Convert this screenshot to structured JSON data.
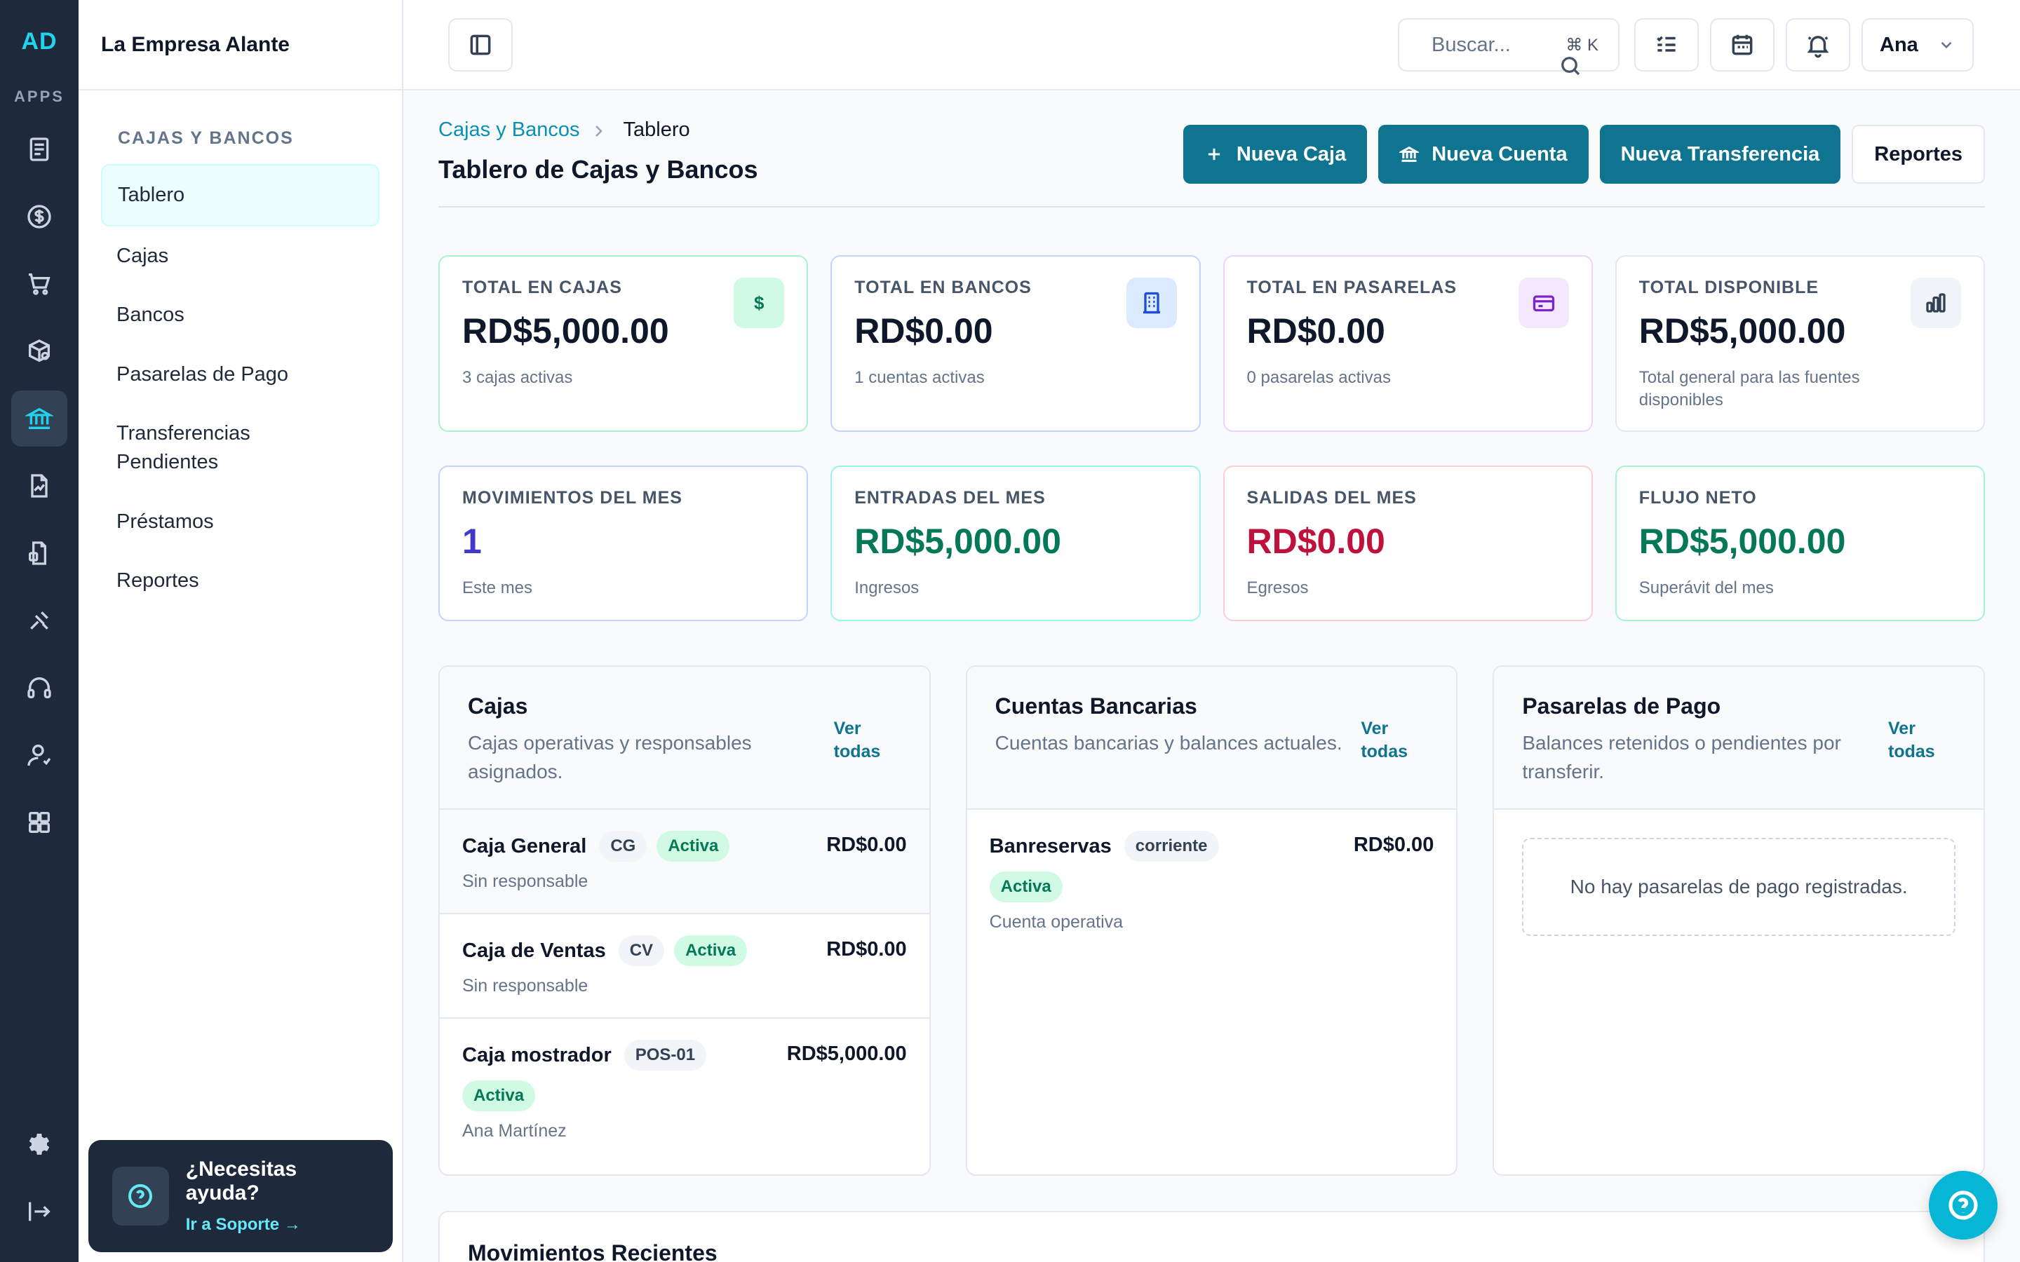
{
  "rail": {
    "logo": "AD",
    "apps_label": "APPS",
    "icons": [
      "document-icon",
      "dollar-icon",
      "cart-icon",
      "package-icon",
      "bank-icon",
      "report-icon",
      "file-chart-icon",
      "tools-icon",
      "headset-icon",
      "user-icon",
      "grid-icon"
    ],
    "bottom_icons": [
      "gear-icon",
      "logout-icon"
    ]
  },
  "sidebar": {
    "company": "La Empresa Alante",
    "section": "CAJAS Y BANCOS",
    "items": [
      {
        "label": "Tablero",
        "active": true
      },
      {
        "label": "Cajas"
      },
      {
        "label": "Bancos"
      },
      {
        "label": "Pasarelas de Pago"
      },
      {
        "label": "Transferencias Pendientes"
      },
      {
        "label": "Préstamos"
      },
      {
        "label": "Reportes"
      }
    ],
    "help": {
      "title": "¿Necesitas ayuda?",
      "link": "Ir a Soporte →"
    }
  },
  "topbar": {
    "search_placeholder": "Buscar...",
    "search_shortcut": "⌘ K",
    "user": "Ana"
  },
  "header": {
    "breadcrumb": [
      "Cajas y Bancos",
      "Tablero"
    ],
    "title": "Tablero de Cajas y Bancos",
    "actions": {
      "new_caja": "Nueva Caja",
      "new_cuenta": "Nueva Cuenta",
      "new_transfer": "Nueva Transferencia",
      "reports": "Reportes"
    }
  },
  "stats": [
    {
      "label": "TOTAL EN CAJAS",
      "value": "RD$5,000.00",
      "sub": "3 cajas activas",
      "icon": "dollar-icon"
    },
    {
      "label": "TOTAL EN BANCOS",
      "value": "RD$0.00",
      "sub": "1 cuentas activas",
      "icon": "building-icon"
    },
    {
      "label": "TOTAL EN PASARELAS",
      "value": "RD$0.00",
      "sub": "0 pasarelas activas",
      "icon": "credit-card-icon"
    },
    {
      "label": "TOTAL DISPONIBLE",
      "value": "RD$5,000.00",
      "sub": "Total general para las fuentes disponibles",
      "icon": "bar-chart-icon"
    },
    {
      "label": "MOVIMIENTOS DEL MES",
      "value": "1",
      "sub": "Este mes"
    },
    {
      "label": "ENTRADAS DEL MES",
      "value": "RD$5,000.00",
      "sub": "Ingresos"
    },
    {
      "label": "SALIDAS DEL MES",
      "value": "RD$0.00",
      "sub": "Egresos"
    },
    {
      "label": "FLUJO NETO",
      "value": "RD$5,000.00",
      "sub": "Superávit del mes"
    }
  ],
  "panels": {
    "cajas": {
      "title": "Cajas",
      "desc": "Cajas operativas y responsables asignados.",
      "link": "Ver todas",
      "rows": [
        {
          "name": "Caja General",
          "code": "CG",
          "status": "Activa",
          "sub": "Sin responsable",
          "amount": "RD$0.00"
        },
        {
          "name": "Caja de Ventas",
          "code": "CV",
          "status": "Activa",
          "sub": "Sin responsable",
          "amount": "RD$0.00"
        },
        {
          "name": "Caja mostrador",
          "code": "POS-01",
          "status": "Activa",
          "sub": "Ana Martínez",
          "amount": "RD$5,000.00"
        }
      ]
    },
    "cuentas": {
      "title": "Cuentas Bancarias",
      "desc": "Cuentas bancarias y balances actuales.",
      "link": "Ver todas",
      "rows": [
        {
          "name": "Banreservas",
          "code": "corriente",
          "status": "Activa",
          "sub": "Cuenta operativa",
          "amount": "RD$0.00"
        }
      ]
    },
    "pasarelas": {
      "title": "Pasarelas de Pago",
      "desc": "Balances retenidos o pendientes por transferir.",
      "link": "Ver todas",
      "empty": "No hay pasarelas de pago registradas."
    }
  },
  "recent": {
    "title": "Movimientos Recientes"
  }
}
